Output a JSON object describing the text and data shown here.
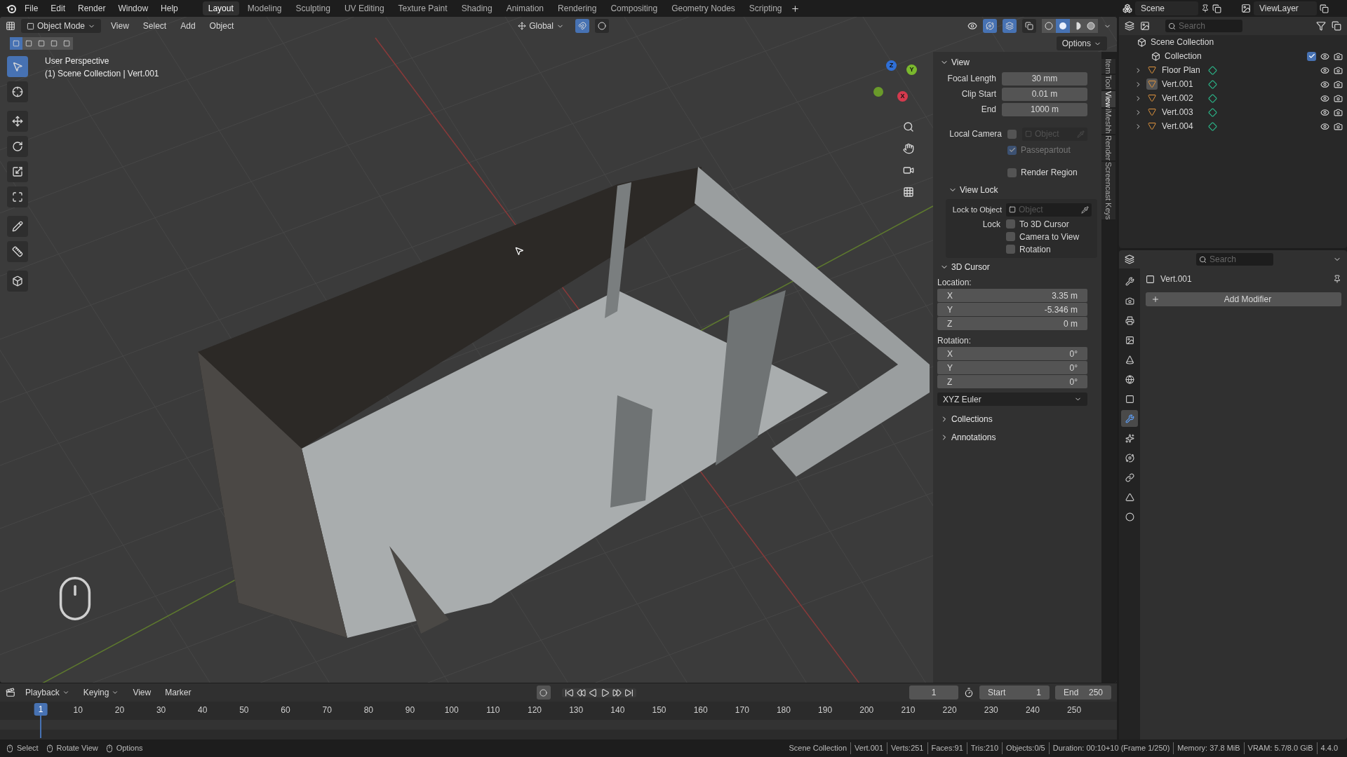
{
  "top_menu": [
    "File",
    "Edit",
    "Render",
    "Window",
    "Help"
  ],
  "workspaces": [
    {
      "label": "Layout",
      "selected": true
    },
    {
      "label": "Modeling",
      "selected": false
    },
    {
      "label": "Sculpting",
      "selected": false
    },
    {
      "label": "UV Editing",
      "selected": false
    },
    {
      "label": "Texture Paint",
      "selected": false
    },
    {
      "label": "Shading",
      "selected": false
    },
    {
      "label": "Animation",
      "selected": false
    },
    {
      "label": "Rendering",
      "selected": false
    },
    {
      "label": "Compositing",
      "selected": false
    },
    {
      "label": "Geometry Nodes",
      "selected": false
    },
    {
      "label": "Scripting",
      "selected": false
    }
  ],
  "scene": {
    "name": "Scene",
    "view_layer": "ViewLayer"
  },
  "viewport_header": {
    "mode": "Object Mode",
    "menus": [
      "View",
      "Select",
      "Add",
      "Object"
    ],
    "orientation": "Global",
    "toggles": [
      {
        "kind": "snap",
        "on": true
      },
      {
        "kind": "proportional",
        "on": false
      },
      {
        "kind": "gizmo",
        "on": true
      },
      {
        "kind": "overlay",
        "on": true
      },
      {
        "kind": "xray",
        "on": false
      }
    ],
    "shading": [
      {
        "kind": "wireframe",
        "selected": false
      },
      {
        "kind": "solid",
        "selected": true
      },
      {
        "kind": "material",
        "selected": false
      },
      {
        "kind": "rendered",
        "selected": false
      }
    ],
    "options": "Options"
  },
  "select_modes": [
    {
      "selected": true
    },
    {
      "selected": false
    },
    {
      "selected": false
    },
    {
      "selected": false
    },
    {
      "selected": false
    }
  ],
  "tools": [
    {
      "kind": "select",
      "selected": true
    },
    {
      "kind": "cursor",
      "selected": false
    },
    {
      "kind": "move",
      "selected": false
    },
    {
      "kind": "rotate",
      "selected": false
    },
    {
      "kind": "scale",
      "selected": false
    },
    {
      "kind": "transform",
      "selected": false
    },
    {
      "kind": "annotate",
      "selected": false
    },
    {
      "kind": "measure",
      "selected": false
    },
    {
      "kind": "add_cube",
      "selected": false
    }
  ],
  "viewport_info": [
    "User Perspective",
    "(1) Scene Collection | Vert.001"
  ],
  "gizmo_axes": [
    "Z",
    "Y",
    "X"
  ],
  "sidebar_tabs": [
    {
      "label": "Item",
      "selected": false
    },
    {
      "label": "Tool",
      "selected": false
    },
    {
      "label": "View",
      "selected": true
    },
    {
      "label": "iMeshh",
      "selected": false
    },
    {
      "label": "Render",
      "selected": false
    },
    {
      "label": "Screencast Keys",
      "selected": false
    }
  ],
  "view_panel": {
    "title": "View",
    "expanded": true,
    "fields": [
      {
        "label": "Focal Length",
        "value": "30 mm"
      },
      {
        "label": "Clip Start",
        "value": "0.01 m"
      },
      {
        "label": "End",
        "value": "1000 m"
      }
    ],
    "local_camera": {
      "label": "Local Camera",
      "checked": false,
      "placeholder": "Object"
    },
    "passepartout": {
      "label": "Passepartout",
      "checked": true,
      "disabled": true
    },
    "render_region": {
      "label": "Render Region",
      "checked": false
    },
    "view_lock": {
      "title": "View Lock",
      "expanded": true,
      "lock_to_object": {
        "label": "Lock to Object",
        "placeholder": "Object"
      },
      "lock_label": "Lock",
      "options": [
        {
          "label": "To 3D Cursor",
          "checked": false
        },
        {
          "label": "Camera to View",
          "checked": false
        },
        {
          "label": "Rotation",
          "checked": false
        }
      ]
    }
  },
  "cursor_panel": {
    "title": "3D Cursor",
    "expanded": true,
    "location_label": "Location:",
    "location": [
      {
        "axis": "X",
        "value": "3.35 m"
      },
      {
        "axis": "Y",
        "value": "-5.346 m"
      },
      {
        "axis": "Z",
        "value": "0 m"
      }
    ],
    "rotation_label": "Rotation:",
    "rotation": [
      {
        "axis": "X",
        "value": "0°"
      },
      {
        "axis": "Y",
        "value": "0°"
      },
      {
        "axis": "Z",
        "value": "0°"
      }
    ],
    "rotation_mode": "XYZ Euler"
  },
  "collapsed_panels": [
    {
      "title": "Collections",
      "expanded": false
    },
    {
      "title": "Annotations",
      "expanded": false
    }
  ],
  "outliner": {
    "search_placeholder": "Search",
    "root": "Scene Collection",
    "collection": {
      "name": "Collection",
      "checked": true,
      "children": [
        {
          "name": "Floor Plan",
          "selected": false,
          "expanded": false
        },
        {
          "name": "Vert.001",
          "selected": true,
          "expanded": false
        },
        {
          "name": "Vert.002",
          "selected": false,
          "expanded": false
        },
        {
          "name": "Vert.003",
          "selected": false,
          "expanded": false
        },
        {
          "name": "Vert.004",
          "selected": false,
          "expanded": false
        }
      ]
    }
  },
  "properties": {
    "search_placeholder": "Search",
    "object": "Vert.001",
    "add_modifier": "Add Modifier",
    "tabs": [
      {
        "kind": "tool",
        "selected": false
      },
      {
        "kind": "render",
        "selected": false
      },
      {
        "kind": "output",
        "selected": false
      },
      {
        "kind": "view_layer",
        "selected": false
      },
      {
        "kind": "scene",
        "selected": false
      },
      {
        "kind": "world",
        "selected": false
      },
      {
        "kind": "object",
        "selected": false
      },
      {
        "kind": "modifiers",
        "selected": true
      },
      {
        "kind": "particles",
        "selected": false
      },
      {
        "kind": "physics",
        "selected": false
      },
      {
        "kind": "constraints",
        "selected": false
      },
      {
        "kind": "data",
        "selected": false
      },
      {
        "kind": "material",
        "selected": false
      }
    ]
  },
  "timeline": {
    "menus": [
      "Playback",
      "Keying",
      "View",
      "Marker"
    ],
    "current_frame": "1",
    "start_label": "Start",
    "start": "1",
    "end_label": "End",
    "end": "250",
    "marker": "1",
    "ticks": [
      "10",
      "20",
      "30",
      "40",
      "50",
      "60",
      "70",
      "80",
      "90",
      "100",
      "110",
      "120",
      "130",
      "140",
      "150",
      "160",
      "170",
      "180",
      "190",
      "200",
      "210",
      "220",
      "230",
      "240",
      "250"
    ]
  },
  "status_bar": {
    "hints": [
      "Select",
      "Rotate View",
      "Options"
    ],
    "stats": [
      "Scene Collection",
      "Vert.001",
      "Verts:251",
      "Faces:91",
      "Tris:210",
      "Objects:0/5",
      "Duration: 00:10+10 (Frame 1/250)",
      "Memory: 37.8 MiB",
      "VRAM: 5.7/8.0 GiB",
      "4.4.0"
    ]
  }
}
